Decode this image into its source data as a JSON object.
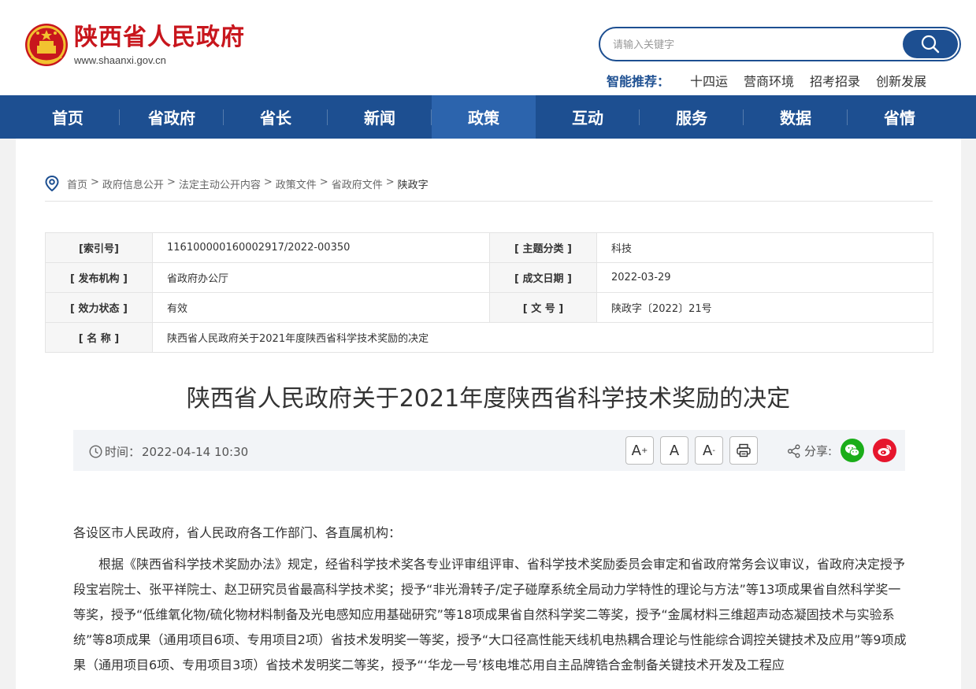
{
  "header": {
    "site_title": "陕西省人民政府",
    "site_url": "www.shaanxi.gov.cn",
    "search_placeholder": "请输入关键字",
    "recommend_label": "智能推荐：",
    "recommend_items": [
      "十四运",
      "营商环境",
      "招考招录",
      "创新发展"
    ]
  },
  "nav": {
    "items": [
      "首页",
      "省政府",
      "省长",
      "新闻",
      "政策",
      "互动",
      "服务",
      "数据",
      "省情"
    ],
    "active": "政策"
  },
  "breadcrumb": [
    "首页",
    "政府信息公开",
    "法定主动公开内容",
    "政策文件",
    "省政府文件",
    "陕政字"
  ],
  "meta": {
    "index_label": "[索引号]",
    "index_value": "116100000160002917/2022-00350",
    "topic_label": "[ 主题分类 ]",
    "topic_value": "科技",
    "publisher_label": "[ 发布机构 ]",
    "publisher_value": "省政府办公厅",
    "date_label": "[ 成文日期 ]",
    "date_value": "2022-03-29",
    "status_label": "[ 效力状态 ]",
    "status_value": "有效",
    "docno_label": "[ 文 号 ]",
    "docno_value": "陕政字〔2022〕21号",
    "name_label": "[ 名 称 ]",
    "name_value": "陕西省人民政府关于2021年度陕西省科学技术奖励的决定"
  },
  "article": {
    "title": "陕西省人民政府关于2021年度陕西省科学技术奖励的决定",
    "time_label": "时间：",
    "time_value": "2022-04-14 10:30",
    "font_large": "A",
    "font_large_sup": "+",
    "font_normal": "A",
    "font_small": "A",
    "font_small_sup": "-",
    "share_label": "分享:",
    "salutation": "各设区市人民政府，省人民政府各工作部门、各直属机构：",
    "paragraph1": "根据《陕西省科学技术奖励办法》规定，经省科学技术奖各专业评审组评审、省科学技术奖励委员会审定和省政府常务会议审议，省政府决定授予段宝岩院士、张平祥院士、赵卫研究员省最高科学技术奖；授予“非光滑转子/定子碰摩系统全局动力学特性的理论与方法”等13项成果省自然科学奖一等奖，授予“低维氧化物/硫化物材料制备及光电感知应用基础研究”等18项成果省自然科学奖二等奖，授予“金属材料三维超声动态凝固技术与实验系统”等8项成果（通用项目6项、专用项目2项）省技术发明奖一等奖，授予“大口径高性能天线机电热耦合理论与性能综合调控关键技术及应用”等9项成果（通用项目6项、专用项目3项）省技术发明奖二等奖，授予“‘华龙一号’核电堆芯用自主品牌锆合金制备关键技术开发及工程应"
  },
  "colors": {
    "brand_blue": "#1d4f91",
    "nav_active": "#2c64ad",
    "logo_red": "#c8161d",
    "wechat_green": "#1aad19",
    "weibo_red": "#e6162d"
  }
}
